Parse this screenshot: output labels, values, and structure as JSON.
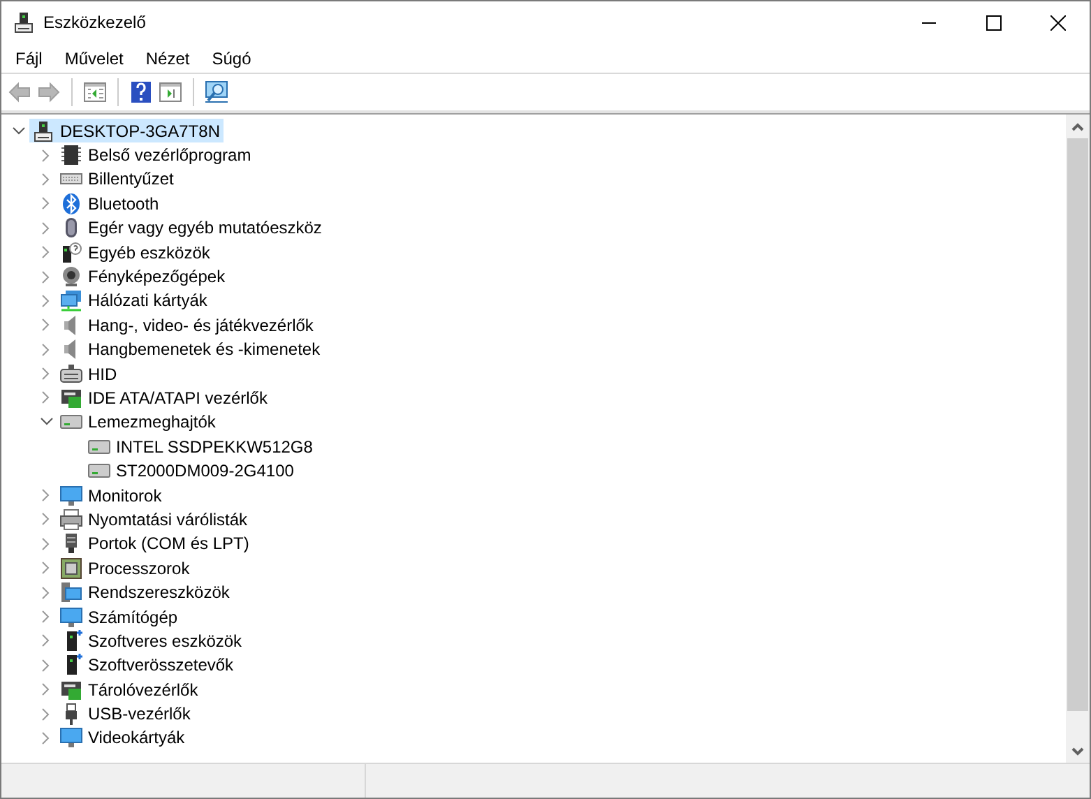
{
  "window": {
    "title": "Eszközkezelő"
  },
  "menu": [
    {
      "label": "Fájl"
    },
    {
      "label": "Művelet"
    },
    {
      "label": "Nézet"
    },
    {
      "label": "Súgó"
    }
  ],
  "toolbar": [
    {
      "kind": "back",
      "disabled": true
    },
    {
      "kind": "forward",
      "disabled": true
    },
    {
      "kind": "separator"
    },
    {
      "kind": "properties",
      "disabled": false
    },
    {
      "kind": "separator"
    },
    {
      "kind": "help",
      "disabled": false
    },
    {
      "kind": "update",
      "disabled": false
    },
    {
      "kind": "separator"
    },
    {
      "kind": "scan",
      "disabled": false
    }
  ],
  "tree": {
    "label": "DESKTOP-3GA7T8N",
    "expanded": true,
    "selected": true,
    "children": [
      {
        "label": "Belső vezérlőprogram",
        "expanded": false,
        "selected": false
      },
      {
        "label": "Billentyűzet",
        "expanded": false,
        "selected": false
      },
      {
        "label": "Bluetooth",
        "expanded": false,
        "selected": false
      },
      {
        "label": "Egér vagy egyéb mutatóeszköz",
        "expanded": false,
        "selected": false
      },
      {
        "label": "Egyéb eszközök",
        "expanded": false,
        "selected": false
      },
      {
        "label": "Fényképezőgépek",
        "expanded": false,
        "selected": false
      },
      {
        "label": "Hálózati kártyák",
        "expanded": false,
        "selected": false
      },
      {
        "label": "Hang-, video- és játékvezérlők",
        "expanded": false,
        "selected": false
      },
      {
        "label": "Hangbemenetek és -kimenetek",
        "expanded": false,
        "selected": false
      },
      {
        "label": "HID",
        "expanded": false,
        "selected": false
      },
      {
        "label": "IDE ATA/ATAPI vezérlők",
        "expanded": false,
        "selected": false
      },
      {
        "label": "Lemezmeghajtók",
        "expanded": true,
        "selected": false,
        "children": [
          {
            "label": "INTEL SSDPEKKW512G8",
            "selected": false
          },
          {
            "label": "ST2000DM009-2G4100",
            "selected": false
          }
        ]
      },
      {
        "label": "Monitorok",
        "expanded": false,
        "selected": false
      },
      {
        "label": "Nyomtatási várólisták",
        "expanded": false,
        "selected": false
      },
      {
        "label": "Portok (COM és LPT)",
        "expanded": false,
        "selected": false
      },
      {
        "label": "Processzorok",
        "expanded": false,
        "selected": false
      },
      {
        "label": "Rendszereszközök",
        "expanded": false,
        "selected": false
      },
      {
        "label": "Számítógép",
        "expanded": false,
        "selected": false
      },
      {
        "label": "Szoftveres eszközök",
        "expanded": false,
        "selected": false
      },
      {
        "label": "Szoftverösszetevők",
        "expanded": false,
        "selected": false
      },
      {
        "label": "Tárolóvezérlők",
        "expanded": false,
        "selected": false
      },
      {
        "label": "USB-vezérlők",
        "expanded": false,
        "selected": false
      },
      {
        "label": "Videokártyák",
        "expanded": false,
        "selected": false
      }
    ]
  }
}
